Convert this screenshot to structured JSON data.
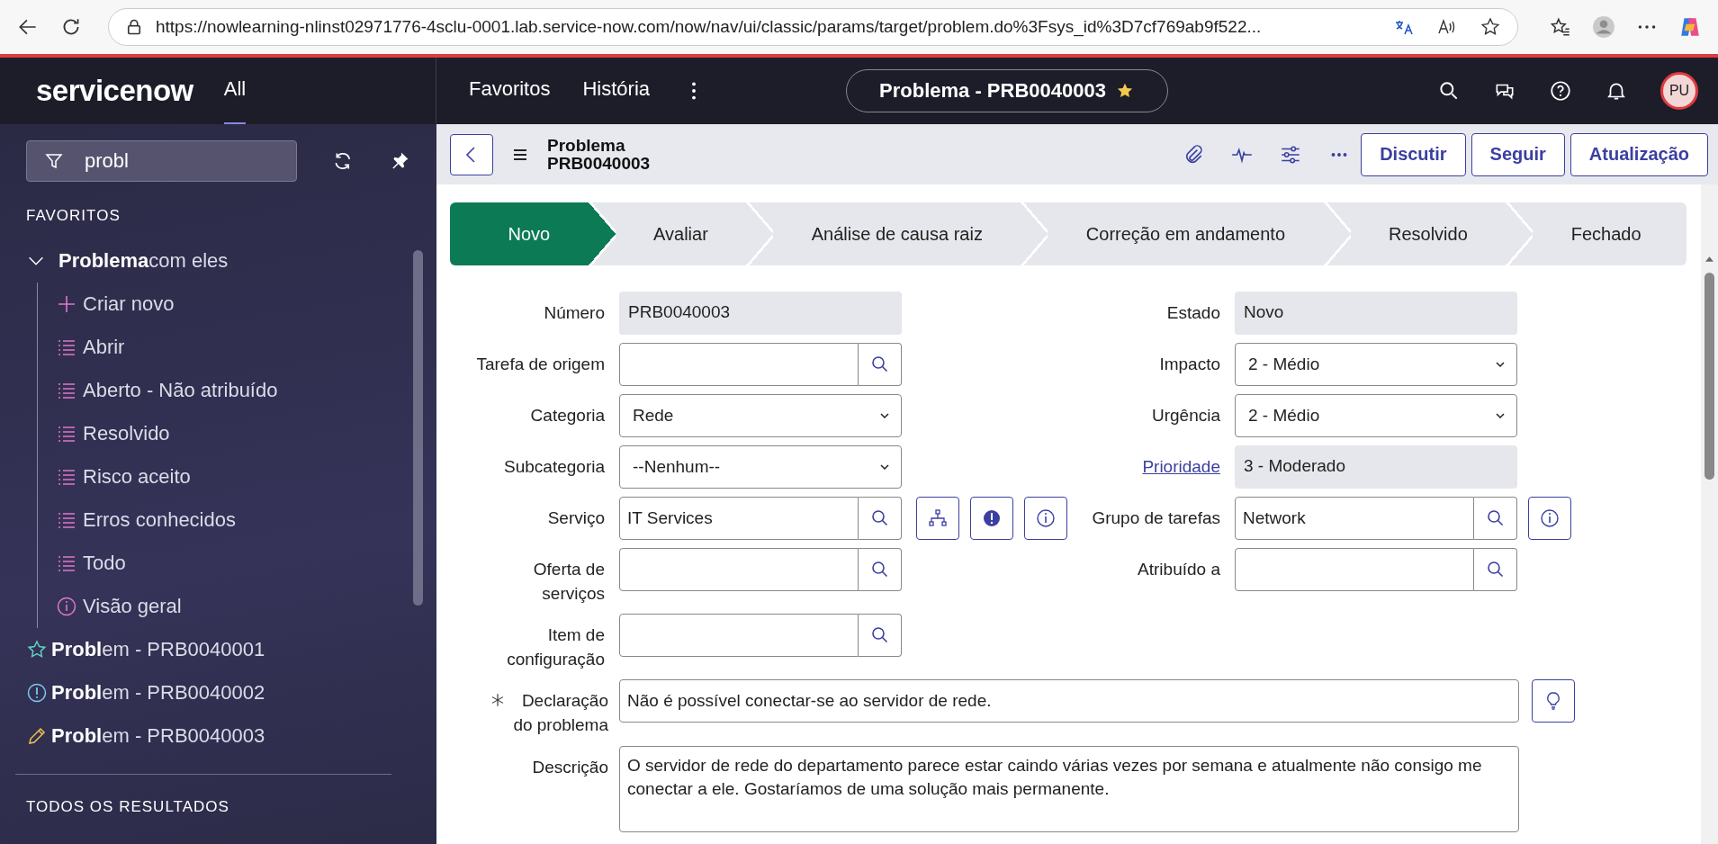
{
  "browser": {
    "url": "https://nowlearning-nlinst02971776-4sclu-0001.lab.service-now.com/now/nav/ui/classic/params/target/problem.do%3Fsys_id%3D7cf769ab9f522..."
  },
  "nav": {
    "logo": "servicenow",
    "menus": [
      {
        "label": "All",
        "selected": true
      },
      {
        "label": "Favoritos",
        "selected": false
      },
      {
        "label": "História",
        "selected": false
      }
    ],
    "record": "Problema - PRB0040003",
    "avatar": "PU"
  },
  "sidebar": {
    "filter": "probl",
    "section": "FAVORITOS",
    "group": {
      "label": "**Problema**com eles",
      "expanded": true,
      "children": [
        {
          "kind": "create",
          "label": "Criar novo"
        },
        {
          "kind": "list",
          "label": "Abrir"
        },
        {
          "kind": "list",
          "label": "Aberto - Não atribuído"
        },
        {
          "kind": "list",
          "label": "Resolvido"
        },
        {
          "kind": "list",
          "label": "Risco aceito"
        },
        {
          "kind": "list",
          "label": "Erros conhecidos"
        },
        {
          "kind": "list",
          "label": "Todo"
        },
        {
          "kind": "info",
          "label": "Visão geral"
        }
      ]
    },
    "items": [
      {
        "kind": "favorite",
        "label": "**Probl**em - PRB0040001"
      },
      {
        "kind": "alert",
        "label": "**Probl**em - PRB0040002"
      },
      {
        "kind": "edit",
        "label": "**Probl**em - PRB0040003"
      }
    ],
    "results_heading": "TODOS OS RESULTADOS"
  },
  "header": {
    "title": "Problema",
    "number": "PRB0040003",
    "buttons": [
      "Discutir",
      "Seguir",
      "Atualização"
    ]
  },
  "stages": [
    {
      "label": "Novo",
      "selected": true
    },
    {
      "label": "Avaliar",
      "selected": false
    },
    {
      "label": "Análise de causa raiz",
      "selected": false
    },
    {
      "label": "Correção em andamento",
      "selected": false
    },
    {
      "label": "Resolvido",
      "selected": false
    },
    {
      "label": "Fechado",
      "selected": false
    }
  ],
  "rows": [
    {
      "left": {
        "label": "Número",
        "link": false,
        "kind": "readonly",
        "value": "PRB0040003"
      },
      "right": {
        "label": "Estado",
        "link": false,
        "kind": "readonly",
        "value": "Novo"
      }
    },
    {
      "left": {
        "label": "Tarefa de origem",
        "link": false,
        "kind": "reference"
      },
      "right": {
        "label": "Impacto",
        "link": false,
        "kind": "select",
        "value": "2 - Médio"
      }
    },
    {
      "left": {
        "label": "Categoria",
        "link": false,
        "kind": "select",
        "value": "Rede"
      },
      "right": {
        "label": "Urgência",
        "link": false,
        "kind": "select",
        "value": "2 - Médio"
      }
    },
    {
      "left": {
        "label": "Subcategoria",
        "link": false,
        "kind": "select",
        "value": "--Nenhum--"
      },
      "right": {
        "label": "Prioridade",
        "link": true,
        "kind": "readonly",
        "value": "3 - Moderado"
      }
    },
    {
      "left": {
        "label": "Serviço",
        "link": false,
        "kind": "reference",
        "value": "IT Services",
        "actions": [
          {
            "kind": "hierarchy"
          },
          {
            "kind": "alert"
          },
          {
            "kind": "info"
          }
        ]
      },
      "right": {
        "label": "Grupo de tarefas",
        "link": false,
        "kind": "reference",
        "value": "Network",
        "actions": [
          {
            "kind": "info"
          }
        ]
      }
    },
    {
      "left": {
        "label": "Oferta de\nserviços",
        "link": false,
        "kind": "reference"
      },
      "right": {
        "label": "Atribuído a",
        "link": false,
        "kind": "reference"
      }
    },
    {
      "left": {
        "label": "Item de\nconfiguração",
        "link": false,
        "kind": "reference"
      }
    }
  ],
  "wide": [
    {
      "label": "Declaração\ndo problema",
      "required": true,
      "kind": "text",
      "value": "Não é possível conectar-se ao servidor de rede.",
      "actions": [
        {
          "kind": "hint"
        }
      ]
    },
    {
      "label": "Descrição",
      "required": false,
      "kind": "textarea",
      "value": "O servidor de rede do departamento parece estar caindo várias vezes por semana e atualmente não consigo me conectar a ele. Gostaríamos de uma solução mais permanente."
    }
  ]
}
